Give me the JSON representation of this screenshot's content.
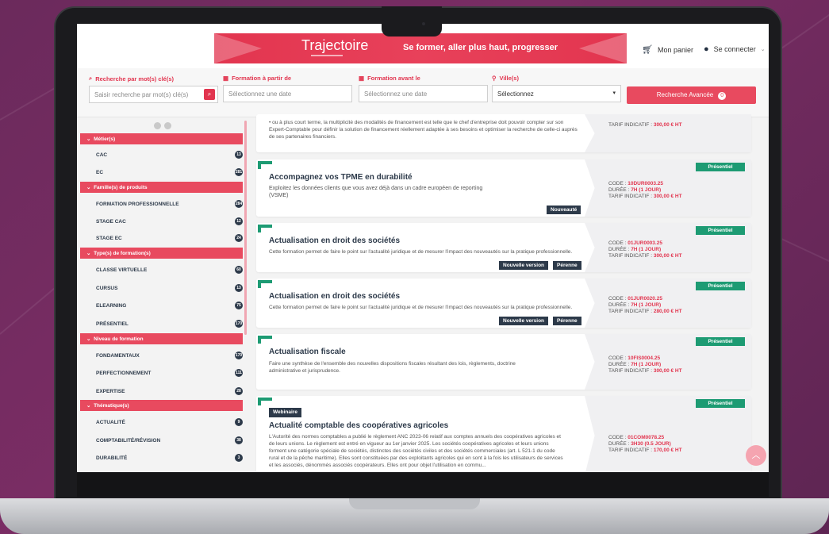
{
  "brand": {
    "name": "Trajectoire",
    "tagline": "Se former, aller plus haut, progresser"
  },
  "header": {
    "cart_label": "Mon panier",
    "login_label": "Se connecter"
  },
  "search": {
    "keyword_label": "Recherche par mot(s) clé(s)",
    "keyword_placeholder": "Saisir recherche par mot(s) clé(s)",
    "from_label": "Formation à partir de",
    "from_placeholder": "Sélectionnez une date",
    "before_label": "Formation avant le",
    "before_placeholder": "Sélectionnez une date",
    "city_label": "Ville(s)",
    "city_value": "Sélectionnez",
    "advanced_label": "Recherche Avancée",
    "advanced_count": "0"
  },
  "sidebar": {
    "metier": {
      "label": "Métier(s)",
      "items": [
        {
          "label": "CAC",
          "count": "13"
        },
        {
          "label": "EC",
          "count": "281"
        }
      ]
    },
    "famille": {
      "label": "Famille(s) de produits",
      "items": [
        {
          "label": "FORMATION PROFESSIONNELLE",
          "count": "284"
        },
        {
          "label": "STAGE CAC",
          "count": "12"
        },
        {
          "label": "STAGE EC",
          "count": "24"
        }
      ]
    },
    "type": {
      "label": "Type(s) de formation(s)",
      "items": [
        {
          "label": "CLASSE VIRTUELLE",
          "count": "60"
        },
        {
          "label": "CURSUS",
          "count": "13"
        },
        {
          "label": "ELEARNING",
          "count": "75"
        },
        {
          "label": "PRÉSENTIEL",
          "count": "170"
        }
      ]
    },
    "niveau": {
      "label": "Niveau de formation",
      "items": [
        {
          "label": "FONDAMENTAUX",
          "count": "170"
        },
        {
          "label": "PERFECTIONNEMENT",
          "count": "111"
        },
        {
          "label": "EXPERTISE",
          "count": "28"
        }
      ]
    },
    "thematique": {
      "label": "Thématique(s)",
      "items": [
        {
          "label": "ACTUALITÉ",
          "count": "9"
        },
        {
          "label": "COMPTABILITÉ/RÉVISION",
          "count": "38"
        },
        {
          "label": "DURABILITÉ",
          "count": "3"
        }
      ]
    }
  },
  "cards": [
    {
      "desc": "• ou à plus court terme, la multiplicité des modalités de financement est telle que le chef d'entreprise doit pouvoir compter sur son Expert-Comptable pour définir la solution de financement réellement adaptée à ses besoins et optimiser la recherche de celle-ci auprès de ses partenaires financiers.",
      "tarif_label": "TARIF INDICATIF :",
      "tarif": "300,00 € HT"
    },
    {
      "title": "Accompagnez vos TPME en durabilité",
      "desc": "Exploitez les données clients que vous avez déjà dans un cadre européen de reporting (VSME)",
      "tag1": "Nouveauté",
      "mode": "Présentiel",
      "code_label": "CODE :",
      "code": "10DUR0003.25",
      "duree_label": "DURÉE :",
      "duree": "7H (1 JOUR)",
      "tarif_label": "TARIF INDICATIF :",
      "tarif": "300,00 € HT"
    },
    {
      "title": "Actualisation en droit des sociétés",
      "desc": "Cette formation permet de faire le point sur l'actualité juridique et de mesurer l'impact des nouveautés sur la pratique professionnelle.",
      "tag1": "Nouvelle version",
      "tag2": "Pérenne",
      "mode": "Présentiel",
      "code_label": "CODE :",
      "code": "01JUR0003.25",
      "duree_label": "DURÉE :",
      "duree": "7H (1 JOUR)",
      "tarif_label": "TARIF INDICATIF :",
      "tarif": "300,00 € HT"
    },
    {
      "title": "Actualisation en droit des sociétés",
      "desc": "Cette formation permet de faire le point sur l'actualité juridique et de mesurer l'impact des nouveautés sur la pratique professionnelle.",
      "tag1": "Nouvelle version",
      "tag2": "Pérenne",
      "mode": "Présentiel",
      "code_label": "CODE :",
      "code": "01JUR0020.25",
      "duree_label": "DURÉE :",
      "duree": "7H (1 JOUR)",
      "tarif_label": "TARIF INDICATIF :",
      "tarif": "280,00 € HT"
    },
    {
      "title": "Actualisation fiscale",
      "desc": "Faire une synthèse de l'ensemble des nouvelles dispositions fiscales résultant des lois, règlements, doctrine administrative et jurisprudence.",
      "mode": "Présentiel",
      "code_label": "CODE :",
      "code": "10FIS0004.25",
      "duree_label": "DURÉE :",
      "duree": "7H (1 JOUR)",
      "tarif_label": "TARIF INDICATIF :",
      "tarif": "300,00 € HT"
    },
    {
      "webinar": "Webinaire",
      "title": "Actualité comptable des coopératives agricoles",
      "desc": "L'Autorité des normes comptables a publié le règlement ANC 2023-06 relatif aux comptes annuels des coopératives agricoles et de leurs unions. Le règlement est entré en vigueur au 1er janvier 2025. Les sociétés coopératives agricoles et leurs unions forment une catégorie spéciale de sociétés, distinctes des sociétés civiles et des sociétés commerciales (art. L 521-1 du code rural et de la pêche maritime). Elles sont constituées par des exploitants agricoles qui en sont à la fois les utilisateurs de services et les associés, dénommés associés coopérateurs. Elles ont pour objet l'utilisation en commu...",
      "mode": "Présentiel",
      "code_label": "CODE :",
      "code": "01COM0078.25",
      "duree_label": "DURÉE :",
      "duree": "3H30 (0.5 JOUR)",
      "tarif_label": "TARIF INDICATIF :",
      "tarif": "170,00 € HT"
    }
  ],
  "colors": {
    "brand_red": "#e2354f",
    "dark": "#2d3a4a",
    "green": "#1d9b73"
  }
}
